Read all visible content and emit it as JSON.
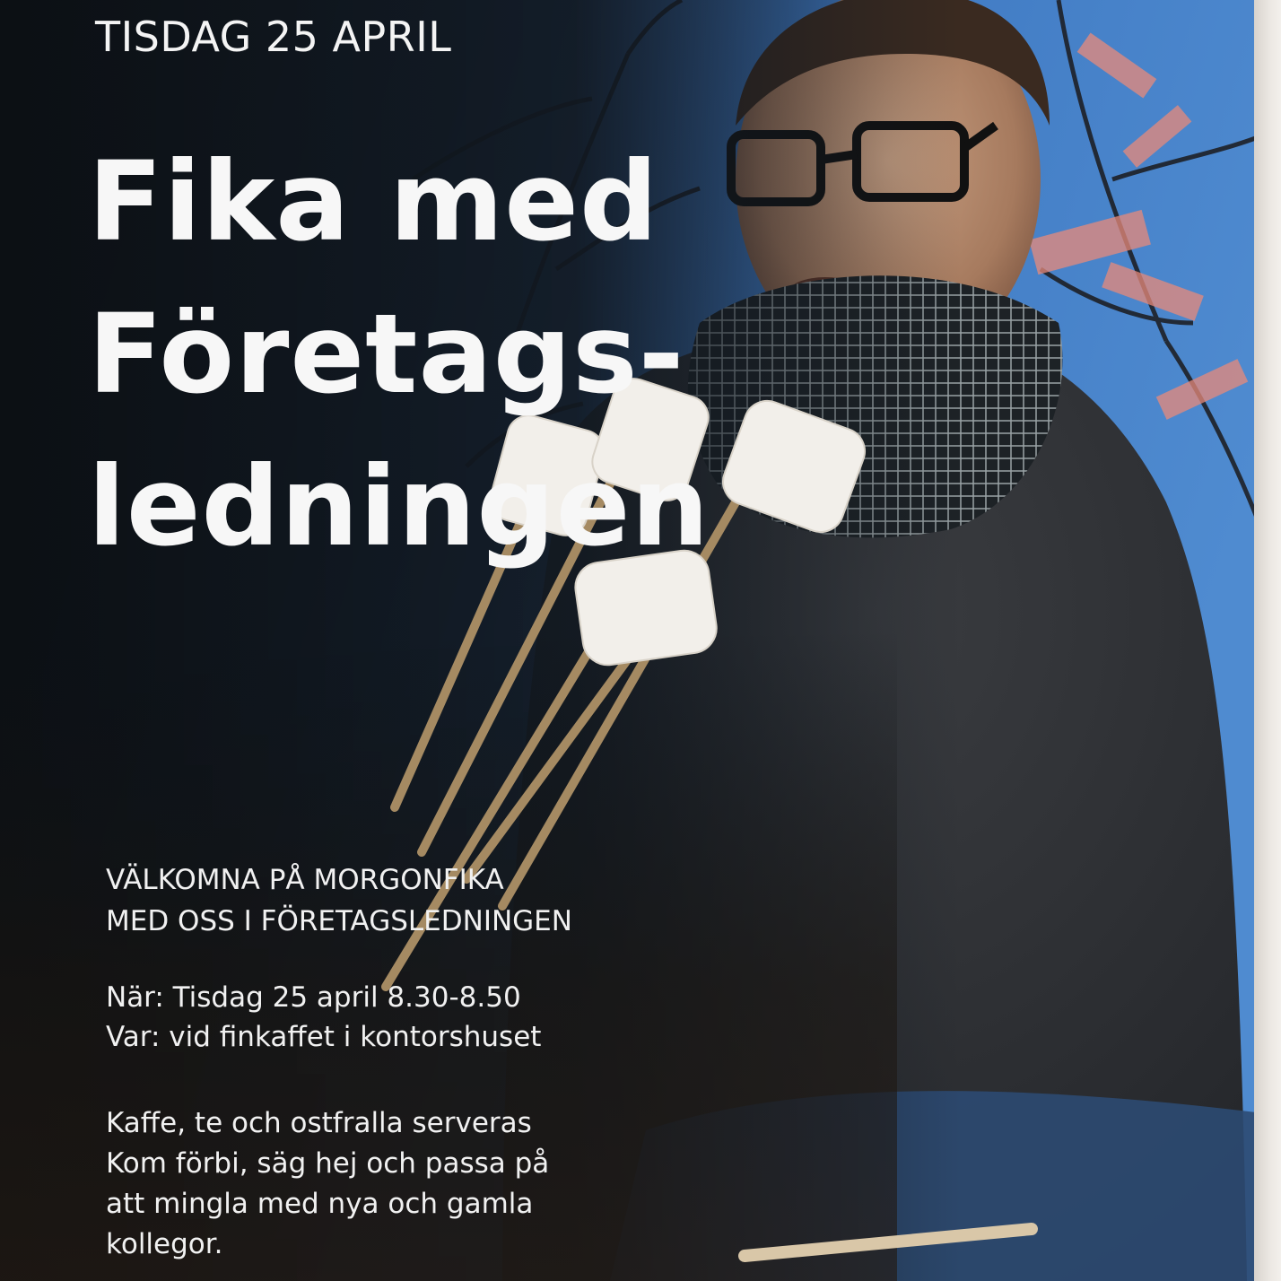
{
  "poster": {
    "date": "TISDAG 25 APRIL",
    "title_lines": [
      "Fika med",
      "Företags-",
      "ledningen"
    ],
    "subtitle_lines": [
      "VÄLKOMNA PÅ MORGONFIKA",
      "MED OSS I FÖRETAGSLEDNINGEN"
    ],
    "when": "När: Tisdag 25 april 8.30-8.50",
    "where": "Var: vid finkaffet i kontorshuset",
    "body_lines": [
      "Kaffe, te och ostfralla serveras",
      "Kom förbi, säg hej och passa på",
      "att mingla med nya och gamla",
      "kollegor."
    ]
  },
  "colors": {
    "background_dark": "#0f1418",
    "sky_blue": "#3f79c2",
    "sweater": "#2f3134",
    "text": "#ffffff"
  }
}
